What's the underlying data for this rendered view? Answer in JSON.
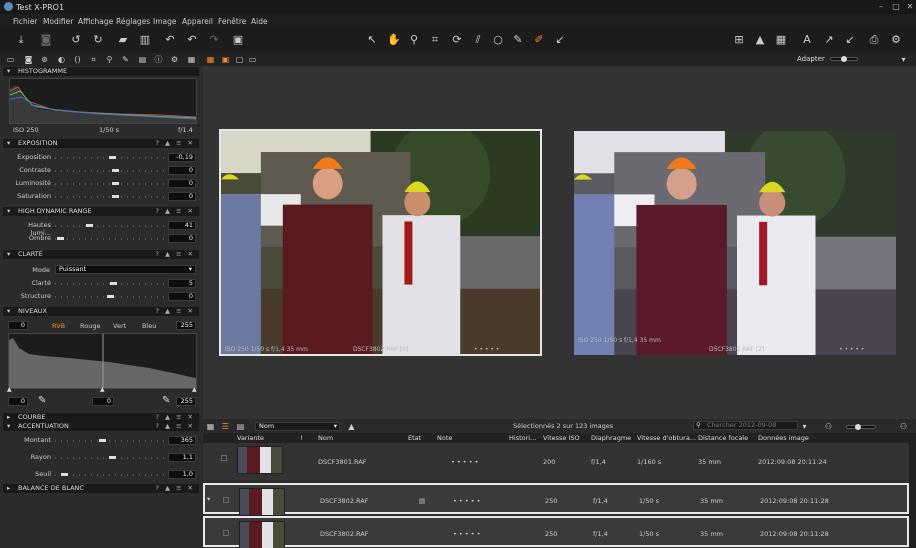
{
  "app": {
    "title": "Test X-PRO1"
  },
  "window_controls": [
    "–",
    "□",
    "✕"
  ],
  "menu": [
    "Fichier",
    "Modifier",
    "Affichage",
    "Réglages",
    "Image",
    "Appareil",
    "Fenêtre",
    "Aide"
  ],
  "toolbar_icons": {
    "left": [
      "import-icon",
      "camera-icon",
      "rotate-left-icon",
      "rotate-right-icon",
      "folder-icon",
      "trash-icon",
      "undo-icon",
      "undo-alt-icon",
      "redo-icon",
      "clone-icon"
    ],
    "center": [
      "cursor-tool-icon",
      "pan-tool-icon",
      "zoom-tool-icon",
      "crop-tool-icon",
      "rotate-tool-icon",
      "keystone-tool-icon",
      "circle-mask-icon",
      "picker-tool-icon",
      "brush-tool-icon",
      "annotate-tool-icon"
    ],
    "right": [
      "grid-icon",
      "warning-icon",
      "exposure-warning-icon",
      "text-icon",
      "arrow-up-icon",
      "arrow-down-icon",
      "print-icon",
      "settings-icon"
    ]
  },
  "tabs_icons": [
    "folder-tab-icon",
    "camera-tab-icon",
    "color-tab-icon",
    "exposure-tab-icon",
    "lens-tab-icon",
    "composition-tab-icon",
    "focus-tab-icon",
    "local-adjust-tab-icon",
    "details-tab-icon",
    "metadata-tab-icon",
    "output-tab-icon",
    "batch-tab-icon"
  ],
  "view_mode_icons": [
    "grid-view-icon",
    "filmstrip-view-icon",
    "single-view-icon",
    "compare-view-icon"
  ],
  "adapter": {
    "label": "Adapter"
  },
  "histogram": {
    "title": "HISTOGRAMME",
    "iso": "ISO 250",
    "shutter": "1/50 s",
    "aperture": "f/1.4"
  },
  "exposure": {
    "title": "EXPOSITION",
    "rows": [
      {
        "label": "Exposition",
        "value": "-0,19",
        "pos": 0.52
      },
      {
        "label": "Contraste",
        "value": "0",
        "pos": 0.55
      },
      {
        "label": "Luminosité",
        "value": "0",
        "pos": 0.55
      },
      {
        "label": "Saturation",
        "value": "0",
        "pos": 0.55
      }
    ]
  },
  "hdr": {
    "title": "HIGH DYNAMIC RANGE",
    "rows": [
      {
        "label": "Hautes lumi...",
        "value": "41",
        "pos": 0.3
      },
      {
        "label": "Ombre",
        "value": "0",
        "pos": 0.02
      }
    ]
  },
  "clarity": {
    "title": "CLARTÉ",
    "mode_label": "Mode",
    "mode_value": "Puissant",
    "rows": [
      {
        "label": "Clarté",
        "value": "5",
        "pos": 0.53
      },
      {
        "label": "Structure",
        "value": "0",
        "pos": 0.5
      }
    ]
  },
  "levels": {
    "title": "NIVEAUX",
    "low": "0",
    "high": "255",
    "channels": [
      "RVB",
      "Rouge",
      "Vert",
      "Bleu"
    ],
    "out_low": "0",
    "out_mid": "0",
    "out_high": "255"
  },
  "curve": {
    "title": "COURBE"
  },
  "sharpening": {
    "title": "ACCENTUATION",
    "rows": [
      {
        "label": "Montant",
        "value": "365",
        "pos": 0.43
      },
      {
        "label": "Rayon",
        "value": "1,1",
        "pos": 0.52
      },
      {
        "label": "Seuil",
        "value": "1,0",
        "pos": 0.06
      }
    ]
  },
  "white_balance": {
    "title": "BALANCE DE BLANC"
  },
  "viewer": {
    "left_caption_exif": "ISO 250  1/50 s  f/1,4  35 mm",
    "left_caption_name": "DSCF3802.RAF [1]",
    "right_caption_exif": "ISO 250  1/50 s  f/1,4  35 mm",
    "right_caption_name": "DSCF3802.RAF [2]",
    "rating_dots": "• • • • •"
  },
  "browser": {
    "sort_label": "Nom",
    "selection_text": "Sélectionnés 2 sur 123 images",
    "search_placeholder": "Chercher 2012-09-08",
    "columns": [
      "Variante",
      "!",
      "Nom",
      "Etat",
      "Note",
      "Histori...",
      "Vitesse ISO",
      "Diaphragme",
      "Vitesse d'obtura...",
      "Distance focale",
      "Données image"
    ],
    "rows": [
      {
        "name": "DSCF3801.RAF",
        "rating": "• • • • •",
        "iso": "200",
        "aperture": "f/1,4",
        "shutter": "1/160 s",
        "focal": "35 mm",
        "date": "2012:09:08 20:11:24",
        "selected": false
      },
      {
        "name": "DSCF3802.RAF",
        "rating": "• • • • •",
        "iso": "250",
        "aperture": "f/1,4",
        "shutter": "1/50 s",
        "focal": "35 mm",
        "date": "2012:09:08 20:11:28",
        "selected": true
      },
      {
        "name": "DSCF3802.RAF",
        "rating": "• • • • •",
        "iso": "250",
        "aperture": "f/1,4",
        "shutter": "1/50 s",
        "focal": "35 mm",
        "date": "2012:09:08 20:11:28",
        "selected": true
      }
    ]
  },
  "colors": {
    "accent": "#f0902a",
    "panel_bg": "#2b2b2b",
    "header_bg": "#1a1a1a",
    "viewer_bg": "#333333"
  }
}
